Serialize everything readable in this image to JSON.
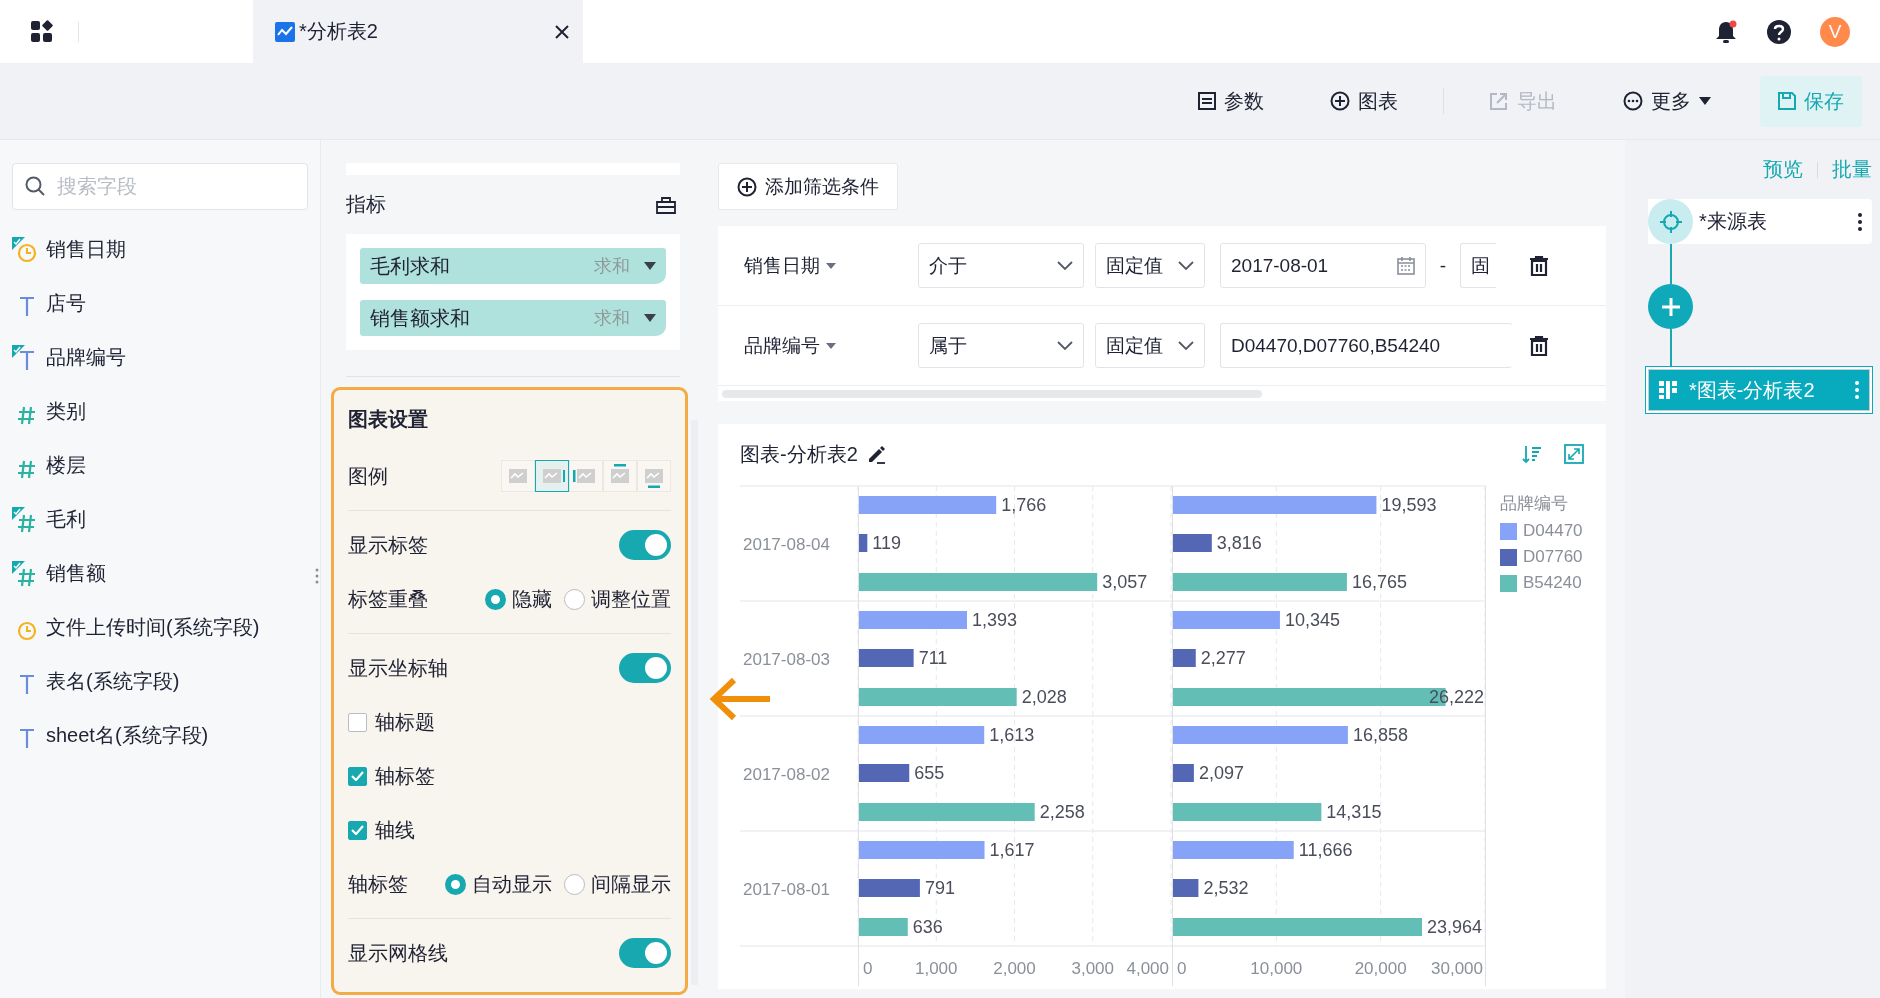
{
  "header": {
    "tabs": [
      {
        "label": "*分析表2",
        "selected": true
      }
    ],
    "user": {
      "initial": "V"
    }
  },
  "toolbar": {
    "buttons": [
      {
        "kind": "params",
        "label": "参数",
        "disabled": false
      },
      {
        "kind": "chart",
        "label": "图表",
        "disabled": false
      },
      {
        "kind": "export",
        "label": "导出",
        "disabled": true
      },
      {
        "kind": "more",
        "label": "更多",
        "disabled": false
      },
      {
        "kind": "save",
        "label": "保存",
        "disabled": false
      }
    ]
  },
  "field_panel": {
    "search": {
      "placeholder": "搜索字段"
    },
    "fields": [
      {
        "name": "销售日期",
        "kind": "date",
        "used": true
      },
      {
        "name": "店号",
        "kind": "text",
        "used": false
      },
      {
        "name": "品牌编号",
        "kind": "text",
        "used": true
      },
      {
        "name": "类别",
        "kind": "number",
        "used": false
      },
      {
        "name": "楼层",
        "kind": "number",
        "used": false
      },
      {
        "name": "毛利",
        "kind": "number",
        "used": true
      },
      {
        "name": "销售额",
        "kind": "number",
        "used": true
      },
      {
        "name": "文件上传时间(系统字段)",
        "kind": "date",
        "used": false
      },
      {
        "name": "表名(系统字段)",
        "kind": "text",
        "used": false
      },
      {
        "name": "sheet名(系统字段)",
        "kind": "text",
        "used": false
      }
    ]
  },
  "measures": {
    "title": "指标",
    "items": [
      {
        "label": "毛利求和",
        "aggregation": "求和"
      },
      {
        "label": "销售额求和",
        "aggregation": "求和"
      }
    ]
  },
  "chart_settings": {
    "title": "图表设置",
    "sections": [
      [
        {
          "kind": "legend",
          "label": "图例",
          "options": [
            {
              "kind": "none",
              "selected": false
            },
            {
              "kind": "right",
              "selected": true
            },
            {
              "kind": "left",
              "selected": false
            },
            {
              "kind": "top",
              "selected": false
            },
            {
              "kind": "bottom",
              "selected": false
            }
          ]
        }
      ],
      [
        {
          "kind": "toggle",
          "label": "显示标签",
          "on": true
        },
        {
          "kind": "radio",
          "label": "标签重叠",
          "options": [
            {
              "label": "隐藏",
              "selected": true
            },
            {
              "label": "调整位置",
              "selected": false
            }
          ]
        }
      ],
      [
        {
          "kind": "toggle",
          "label": "显示坐标轴",
          "on": true
        },
        {
          "kind": "checkbox",
          "label": "轴标题",
          "checked": false
        },
        {
          "kind": "checkbox",
          "label": "轴标签",
          "checked": true
        },
        {
          "kind": "checkbox",
          "label": "轴线",
          "checked": true
        },
        {
          "kind": "radio",
          "label": "轴标签",
          "options": [
            {
              "label": "自动显示",
              "selected": true
            },
            {
              "label": "间隔显示",
              "selected": false
            }
          ]
        }
      ],
      [
        {
          "kind": "toggle",
          "label": "显示网格线",
          "on": true
        }
      ]
    ]
  },
  "filters": {
    "add_button": "添加筛选条件",
    "rows": [
      {
        "field": "销售日期",
        "operator": "介于",
        "value_type": "固定值",
        "values": [
          {
            "kind": "date",
            "text": "2017-08-01"
          },
          {
            "kind": "separator",
            "text": "-"
          },
          {
            "kind": "select",
            "text": "固"
          }
        ]
      },
      {
        "field": "品牌编号",
        "operator": "属于",
        "value_type": "固定值",
        "values": [
          {
            "kind": "text",
            "text": "D04470,D07760,B54240"
          }
        ]
      }
    ]
  },
  "chart": {
    "title": "图表-分析表2",
    "legend_title": "品牌编号",
    "panels": [
      {
        "chart_data": {
          "type": "bar",
          "orientation": "horizontal",
          "grid": true,
          "categories": [
            "2017-08-04",
            "2017-08-03",
            "2017-08-02",
            "2017-08-01"
          ],
          "xlim": [
            0,
            4000
          ],
          "xticks": [
            {
              "value": 0,
              "label": "0"
            },
            {
              "value": 1000,
              "label": "1,000"
            },
            {
              "value": 2000,
              "label": "2,000"
            },
            {
              "value": 3000,
              "label": "3,000"
            },
            {
              "value": 4000,
              "label": "4,000"
            }
          ],
          "series": [
            {
              "name": "D04470",
              "color": "#87a3f7",
              "values": [
                1766,
                1393,
                1613,
                1617
              ],
              "value_labels": [
                "1,766",
                "1,393",
                "1,613",
                "1,617"
              ]
            },
            {
              "name": "D07760",
              "color": "#5367b4",
              "values": [
                119,
                711,
                655,
                791
              ],
              "value_labels": [
                "119",
                "711",
                "655",
                "791"
              ]
            },
            {
              "name": "B54240",
              "color": "#63bfb6",
              "values": [
                3057,
                2028,
                2258,
                636
              ],
              "value_labels": [
                "3,057",
                "2,028",
                "2,258",
                "636"
              ]
            }
          ]
        }
      },
      {
        "chart_data": {
          "type": "bar",
          "orientation": "horizontal",
          "grid": true,
          "xlim": [
            0,
            30000
          ],
          "xticks": [
            {
              "value": 0,
              "label": "0"
            },
            {
              "value": 10000,
              "label": "10,000"
            },
            {
              "value": 20000,
              "label": "20,000"
            },
            {
              "value": 30000,
              "label": "30,000"
            }
          ],
          "series": [
            {
              "color": "#87a3f7",
              "values": [
                19593,
                10345,
                16858,
                11666
              ],
              "value_labels": [
                "19,593",
                "10,345",
                "16,858",
                "11,666"
              ]
            },
            {
              "color": "#5367b4",
              "values": [
                3816,
                2277,
                2097,
                2532
              ],
              "value_labels": [
                "3,816",
                "2,277",
                "2,097",
                "2,532"
              ]
            },
            {
              "color": "#63bfb6",
              "values": [
                16765,
                26222,
                14315,
                23964
              ],
              "value_labels": [
                "16,765",
                "26,222",
                "14,315",
                "23,964"
              ]
            }
          ]
        }
      }
    ]
  },
  "flow": {
    "links": [
      "预览",
      "批量"
    ],
    "nodes": [
      {
        "kind": "source",
        "label": "*来源表",
        "selected": false
      },
      {
        "kind": "add"
      },
      {
        "kind": "chart",
        "label": "*图表-分析表2",
        "selected": true
      }
    ]
  }
}
